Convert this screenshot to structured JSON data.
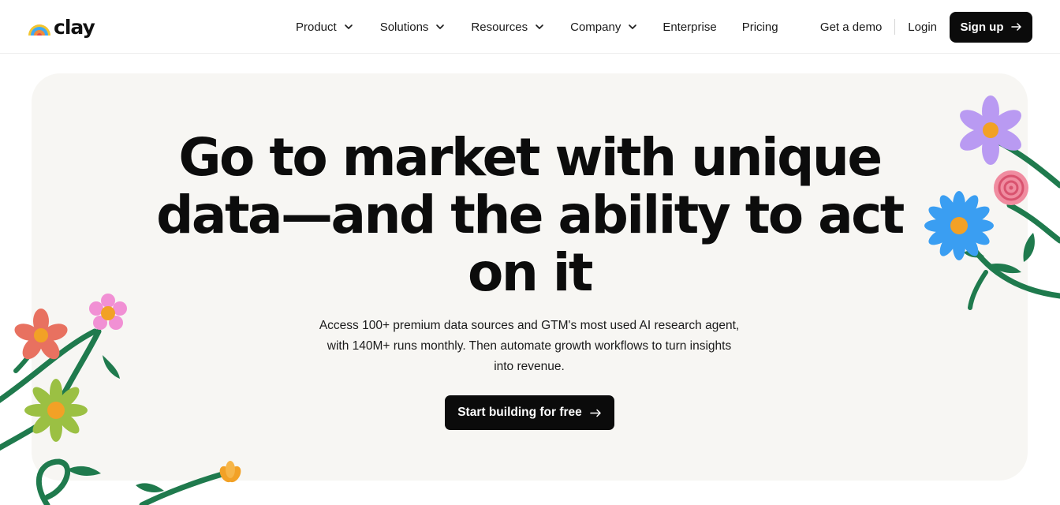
{
  "brand": {
    "name": "clay"
  },
  "nav": {
    "items": [
      {
        "label": "Product",
        "icon": "chevron-down-icon"
      },
      {
        "label": "Solutions",
        "icon": "chevron-down-icon"
      },
      {
        "label": "Resources",
        "icon": "chevron-down-icon"
      },
      {
        "label": "Company",
        "icon": "chevron-down-icon"
      },
      {
        "label": "Enterprise"
      },
      {
        "label": "Pricing"
      }
    ]
  },
  "header_actions": {
    "demo_label": "Get a demo",
    "login_label": "Login",
    "signup_label": "Sign up",
    "signup_icon": "arrow-right-icon"
  },
  "hero": {
    "headline_lines": [
      "Go to market with unique",
      "data—and the ability to act",
      "on it"
    ],
    "subtext_lines": [
      "Access 100+ premium data sources and GTM's most used AI research agent,",
      "with 140M+ runs monthly. Then automate growth workflows to turn insights",
      "into revenue."
    ],
    "cta_label": "Start building for free",
    "cta_icon": "arrow-right-icon"
  },
  "colors": {
    "hero_background": "#f7f6f3",
    "button_background": "#0b0b0b",
    "button_text": "#ffffff",
    "stem_green": "#1f7a4d"
  }
}
